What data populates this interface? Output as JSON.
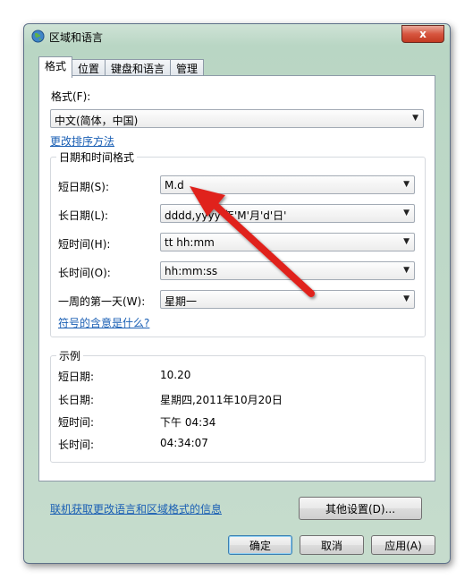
{
  "window": {
    "title": "区域和语言",
    "close_label": "x"
  },
  "tabs": [
    {
      "label": "格式",
      "active": true
    },
    {
      "label": "位置",
      "active": false
    },
    {
      "label": "键盘和语言",
      "active": false
    },
    {
      "label": "管理",
      "active": false
    }
  ],
  "format": {
    "label": "格式(F):",
    "value": "中文(简体，中国)",
    "sort_link": "更改排序方法"
  },
  "datetime": {
    "group_title": "日期和时间格式",
    "rows": [
      {
        "label": "短日期(S):",
        "value": "M.d"
      },
      {
        "label": "长日期(L):",
        "value": "dddd,yyyy'年'M'月'd'日'"
      },
      {
        "label": "短时间(H):",
        "value": "tt hh:mm"
      },
      {
        "label": "长时间(O):",
        "value": "hh:mm:ss"
      },
      {
        "label": "一周的第一天(W):",
        "value": "星期一"
      }
    ],
    "symbol_link": "符号的含意是什么?"
  },
  "example": {
    "group_title": "示例",
    "rows": [
      {
        "label": "短日期:",
        "value": "10.20"
      },
      {
        "label": "长日期:",
        "value": "星期四,2011年10月20日"
      },
      {
        "label": "短时间:",
        "value": "下午 04:34"
      },
      {
        "label": "长时间:",
        "value": "04:34:07"
      }
    ]
  },
  "other_settings_label": "其他设置(D)...",
  "online_link": "联机获取更改语言和区域格式的信息",
  "footer": {
    "ok": "确定",
    "cancel": "取消",
    "apply": "应用(A)"
  },
  "colors": {
    "link": "#1a5fb4",
    "annotation_arrow": "#e0201c"
  }
}
